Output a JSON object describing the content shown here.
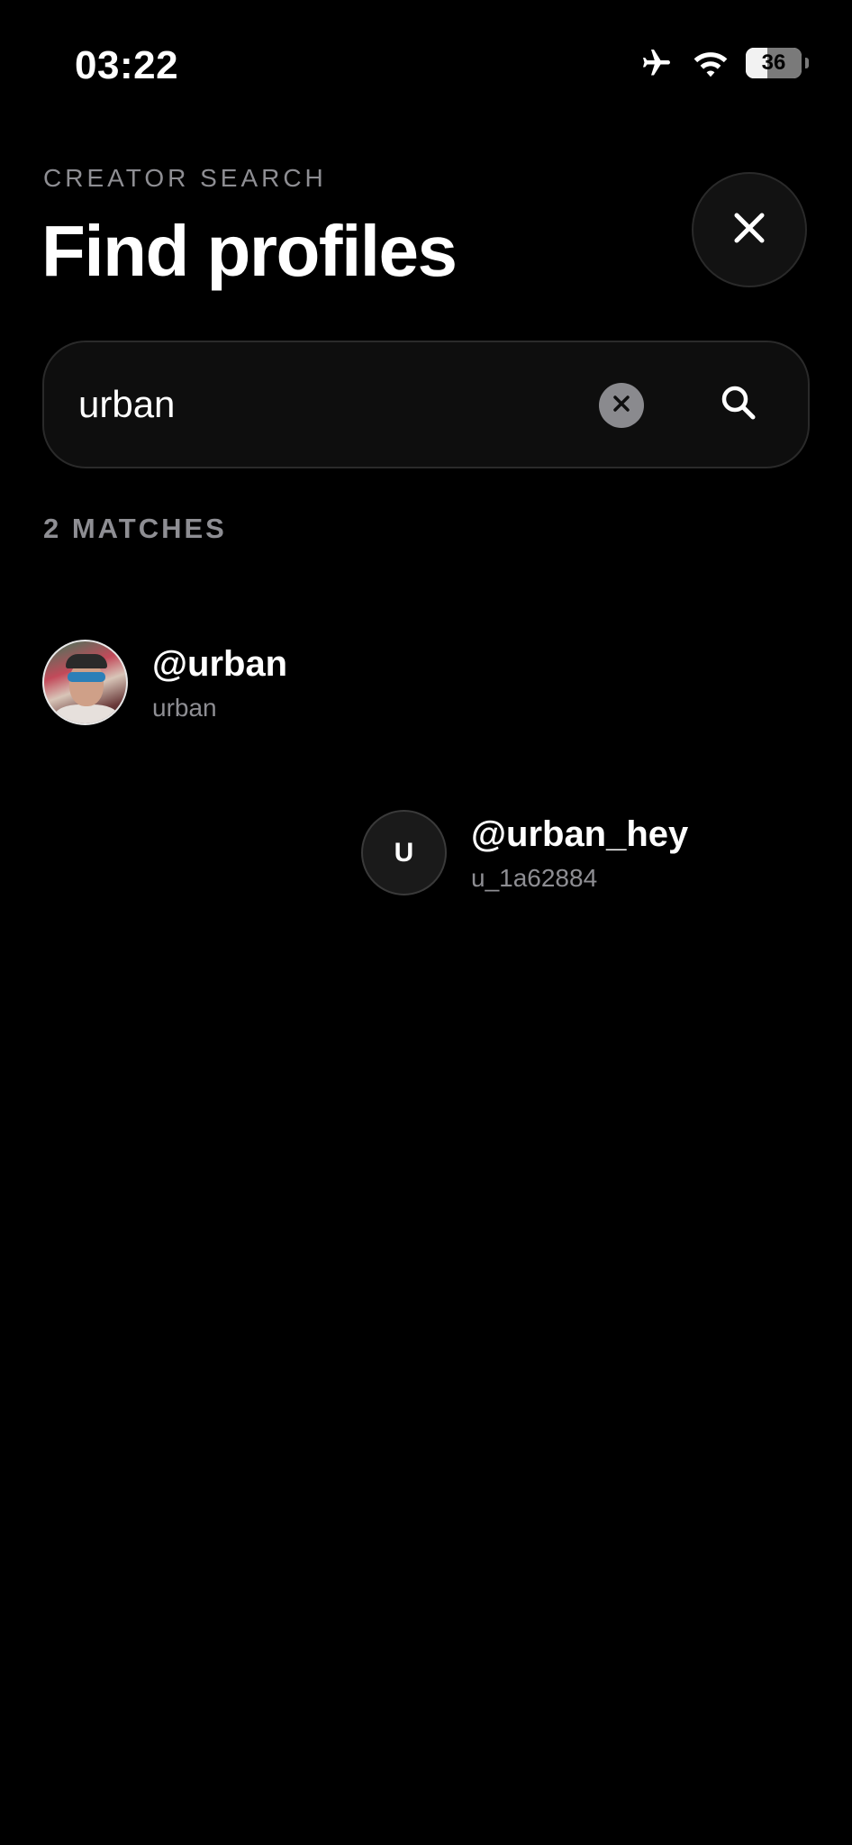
{
  "status_bar": {
    "time": "03:22",
    "battery_level": "36",
    "icons": [
      "airplane-icon",
      "wifi-icon",
      "battery-icon"
    ]
  },
  "header": {
    "eyebrow": "CREATOR SEARCH",
    "title": "Find profiles",
    "close_icon": "close-icon"
  },
  "search": {
    "value": "urban",
    "clear_icon": "clear-icon",
    "search_icon": "search-icon"
  },
  "results": {
    "count_label": "2 MATCHES",
    "items": [
      {
        "handle": "@urban",
        "subtitle": "urban",
        "avatar": "photo"
      },
      {
        "handle": "@urban_hey",
        "subtitle": "u_1a62884",
        "avatar": "initial",
        "initial": "U"
      }
    ]
  },
  "colors": {
    "background": "#000000",
    "muted_text": "#8e8e93",
    "surface": "#0e0e0e",
    "border": "#2a2a2a"
  }
}
